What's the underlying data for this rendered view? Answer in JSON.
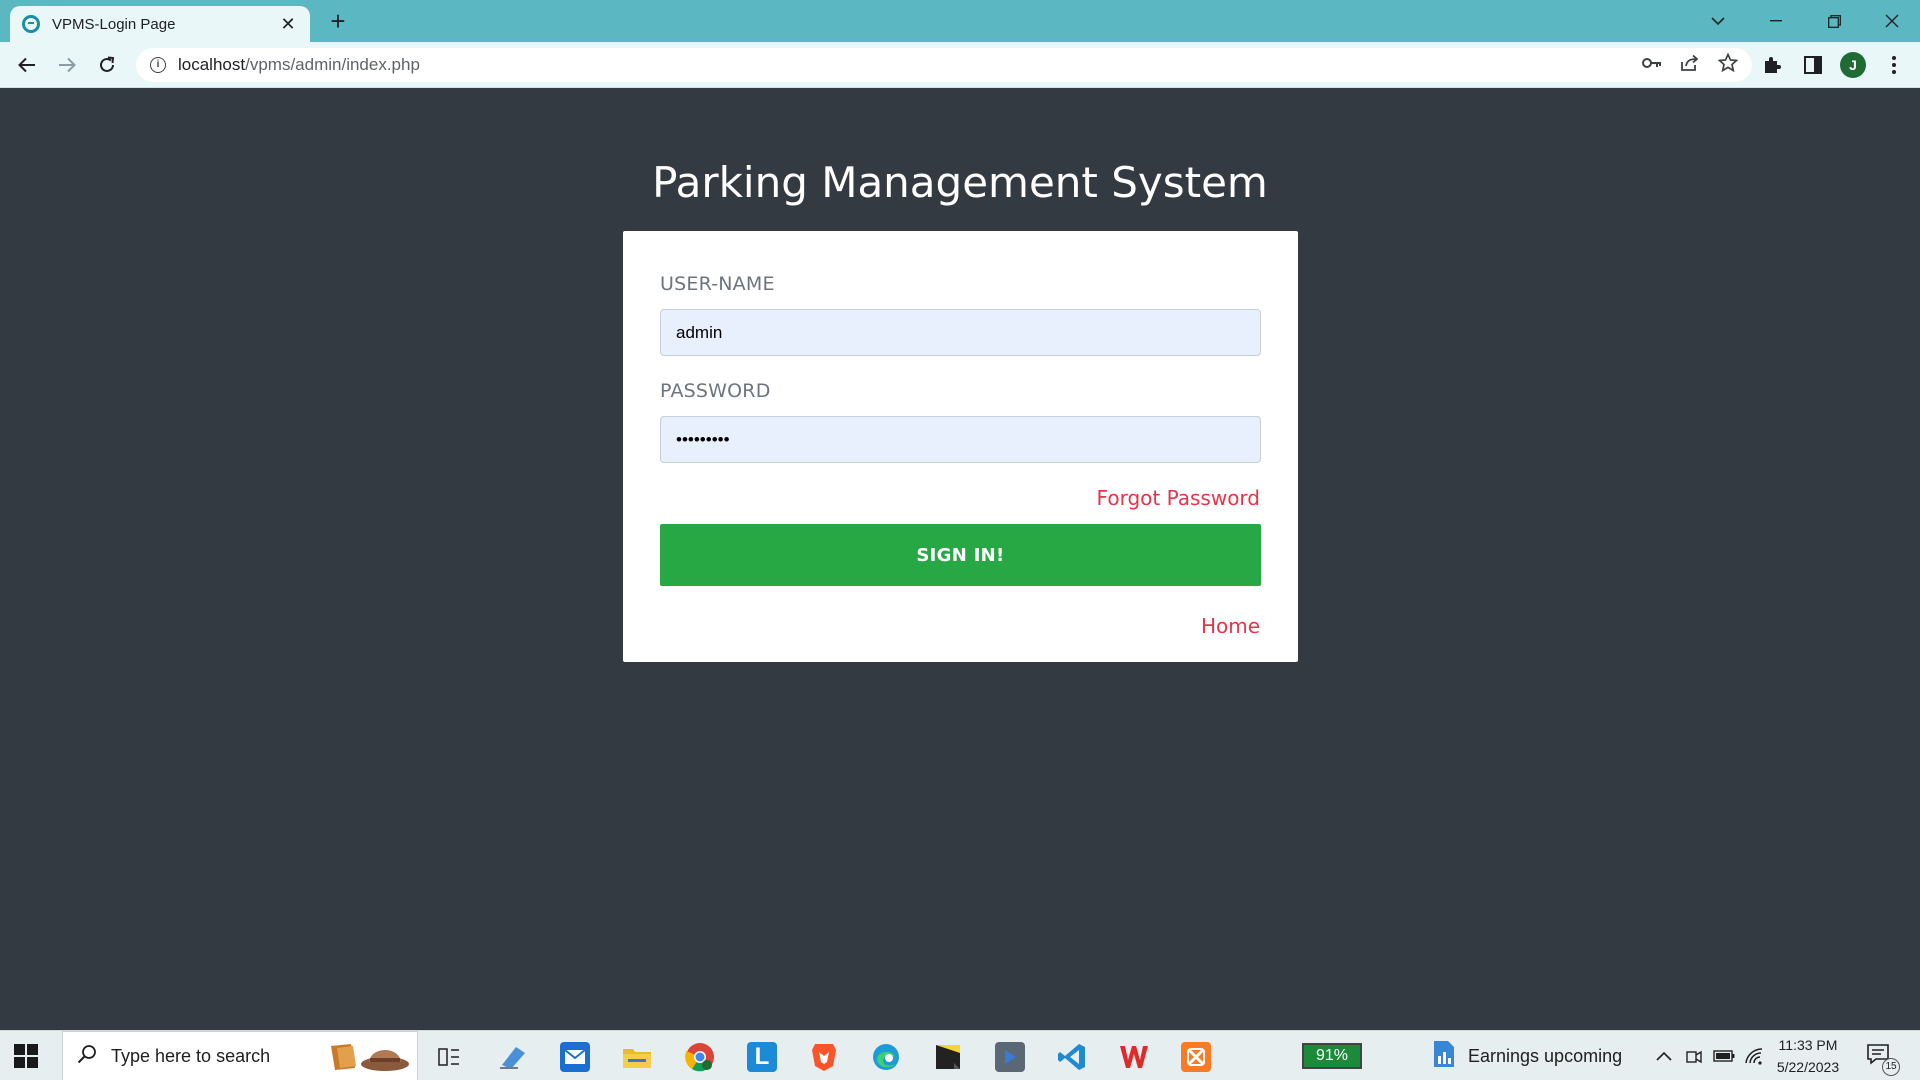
{
  "browser": {
    "tab_title": "VPMS-Login Page",
    "tab_close": "✕",
    "new_tab": "+",
    "url_host": "localhost",
    "url_path": "/vpms/admin/index.php",
    "profile_initial": "J"
  },
  "page": {
    "title": "Parking Management System",
    "username_label": "USER-NAME",
    "username_value": "admin",
    "password_label": "PASSWORD",
    "password_value": "•••••••••",
    "forgot_link": "Forgot Password",
    "signin_button": "SIGN IN!",
    "home_link": "Home"
  },
  "taskbar": {
    "search_placeholder": "Type here to search",
    "battery_widget": "91%",
    "weather_text": "Earnings upcoming",
    "time": "11:33 PM",
    "date": "5/22/2023",
    "notification_count": "15",
    "apps": [
      "file-explorer-icon",
      "mail-icon",
      "folder-icon",
      "chrome-icon",
      "l-app-icon",
      "brave-icon",
      "edge-icon",
      "sticky-notes-icon",
      "media-app-icon",
      "vscode-icon",
      "wps-office-icon",
      "xampp-icon"
    ]
  },
  "colors": {
    "page_background": "#343a42",
    "accent_green": "#28a745",
    "link_red": "#e4364a",
    "chrome_frame": "#5bb8c3"
  }
}
